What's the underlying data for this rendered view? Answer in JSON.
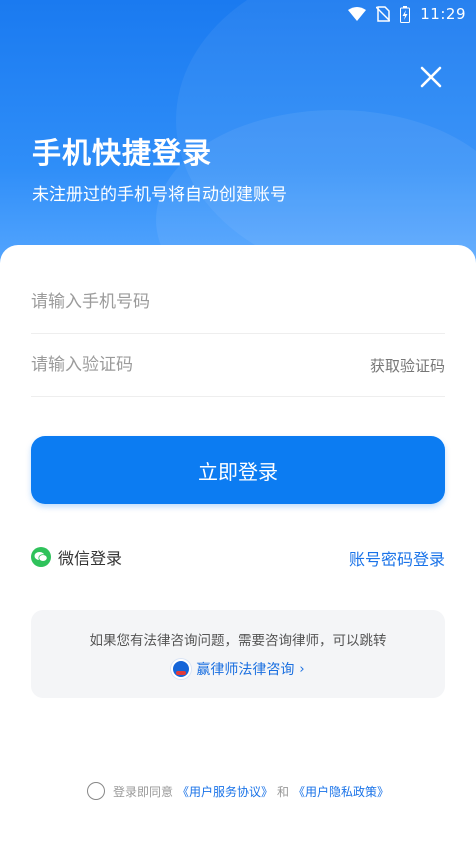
{
  "status_bar": {
    "time": "11:29",
    "icons": [
      "wifi-icon",
      "no-sim-icon",
      "battery-charging-icon"
    ]
  },
  "header": {
    "close_icon": "close-icon",
    "title": "手机快捷登录",
    "subtitle": "未注册过的手机号将自动创建账号"
  },
  "form": {
    "phone_placeholder": "请输入手机号码",
    "code_placeholder": "请输入验证码",
    "get_code_label": "获取验证码",
    "login_button_label": "立即登录"
  },
  "alt_login": {
    "wechat_icon": "wechat-icon",
    "wechat_label": "微信登录",
    "password_login_label": "账号密码登录"
  },
  "promo": {
    "text": "如果您有法律咨询问题，需要咨询律师，可以跳转",
    "link_label": "赢律师法律咨询",
    "link_arrow": "›"
  },
  "agreement": {
    "prefix": "登录即同意",
    "user_service_link": "《用户服务协议》",
    "conjunction": "和",
    "privacy_link": "《用户隐私政策》"
  },
  "colors": {
    "brand_blue": "#0c7cf2",
    "link_blue": "#1a73e8",
    "wechat_green": "#2fc25b"
  }
}
